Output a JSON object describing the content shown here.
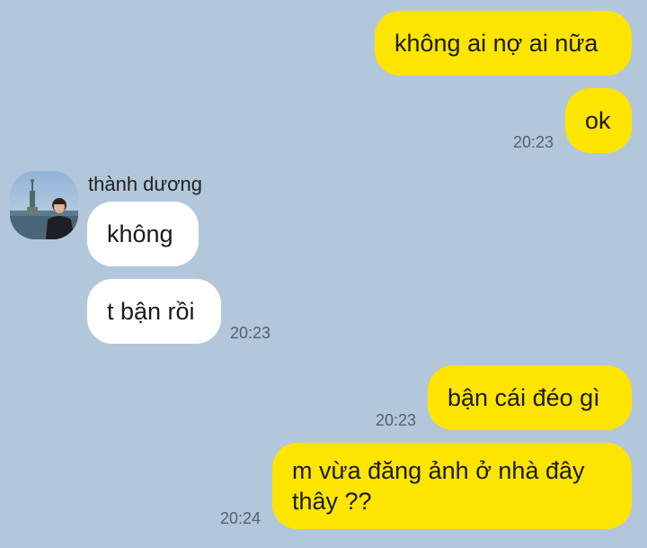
{
  "messages": [
    {
      "text": "không ai nợ ai nữa",
      "side": "sent",
      "time": ""
    },
    {
      "text": "ok",
      "side": "sent",
      "time": "20:23"
    },
    {
      "text": "không",
      "side": "recv",
      "time": ""
    },
    {
      "text": "t bận rồi",
      "side": "recv",
      "time": "20:23"
    },
    {
      "text": "bận cái đéo gì",
      "side": "sent",
      "time": "20:23"
    },
    {
      "text": "m vừa đăng ảnh ở nhà đây thây ??",
      "side": "sent",
      "time": "20:24"
    }
  ],
  "contact": {
    "name": "thành dương",
    "avatar_icon": "profile-photo-statue-of-liberty"
  },
  "colors": {
    "background": "#b2c7da",
    "sent_bubble": "#fee500",
    "received_bubble": "#ffffff"
  }
}
